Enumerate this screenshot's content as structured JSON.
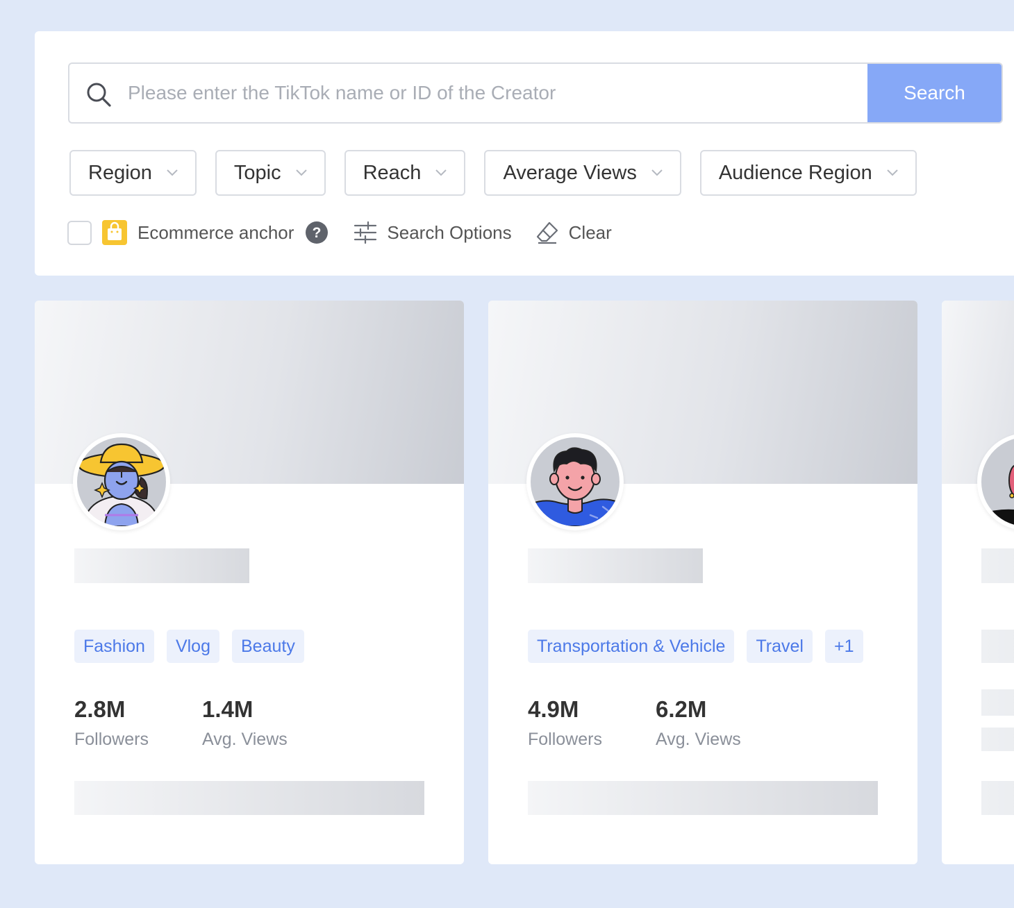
{
  "search": {
    "placeholder": "Please enter the TikTok name or ID of the Creator",
    "button_label": "Search"
  },
  "filters": [
    {
      "label": "Region"
    },
    {
      "label": "Topic"
    },
    {
      "label": "Reach"
    },
    {
      "label": "Average Views"
    },
    {
      "label": "Audience Region"
    }
  ],
  "options": {
    "ecommerce_label": "Ecommerce anchor",
    "ecommerce_checked": false,
    "search_options_label": "Search Options",
    "clear_label": "Clear"
  },
  "cards": [
    {
      "avatar_icon": "woman-with-sun-hat-avatar",
      "tags": [
        "Fashion",
        "Vlog",
        "Beauty"
      ],
      "followers": "2.8M",
      "followers_label": "Followers",
      "avg_views": "1.4M",
      "avg_views_label": "Avg. Views"
    },
    {
      "avatar_icon": "man-swimming-avatar",
      "tags": [
        "Transportation & Vehicle",
        "Travel",
        "+1"
      ],
      "followers": "4.9M",
      "followers_label": "Followers",
      "avg_views": "6.2M",
      "avg_views_label": "Avg. Views"
    }
  ],
  "colors": {
    "background": "#dfe8f8",
    "accent_button": "#86a8f7",
    "tag_text": "#4c79e8",
    "tag_bg": "#ecf1fc",
    "ecommerce_bag": "#f7c531"
  }
}
